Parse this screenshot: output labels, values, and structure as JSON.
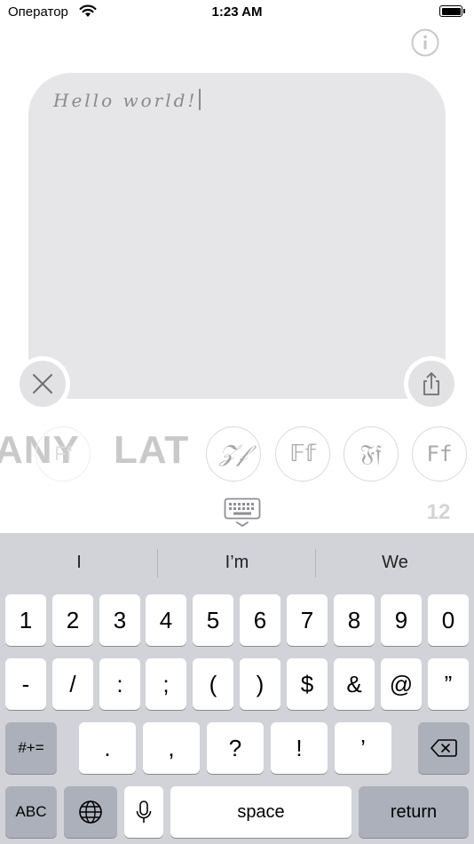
{
  "status_bar": {
    "carrier": "Оператор",
    "time": "1:23 AM"
  },
  "editor": {
    "text": "Hello world!"
  },
  "font_row": {
    "labels": [
      "ANY",
      "LAT"
    ],
    "faded_sample": "Ff",
    "font_samples": [
      "𝒵𝒻",
      "𝔽𝕗",
      "𝔉𝔣",
      "Ff"
    ]
  },
  "font_size": "12",
  "keyboard": {
    "suggestions": [
      "I",
      "I’m",
      "We"
    ],
    "row1": [
      "1",
      "2",
      "3",
      "4",
      "5",
      "6",
      "7",
      "8",
      "9",
      "0"
    ],
    "row2": [
      "-",
      "/",
      ":",
      ";",
      "(",
      ")",
      "$",
      "&",
      "@",
      "”"
    ],
    "row3": [
      ".",
      ",",
      "?",
      "!",
      "’"
    ],
    "symbols_key": "#+=",
    "abc_key": "ABC",
    "space_key": "space",
    "return_key": "return"
  },
  "colors": {
    "editor_bg": "#e6e6e8",
    "keyboard_bg": "#d1d3d9",
    "dark_key": "#acb0ba"
  }
}
